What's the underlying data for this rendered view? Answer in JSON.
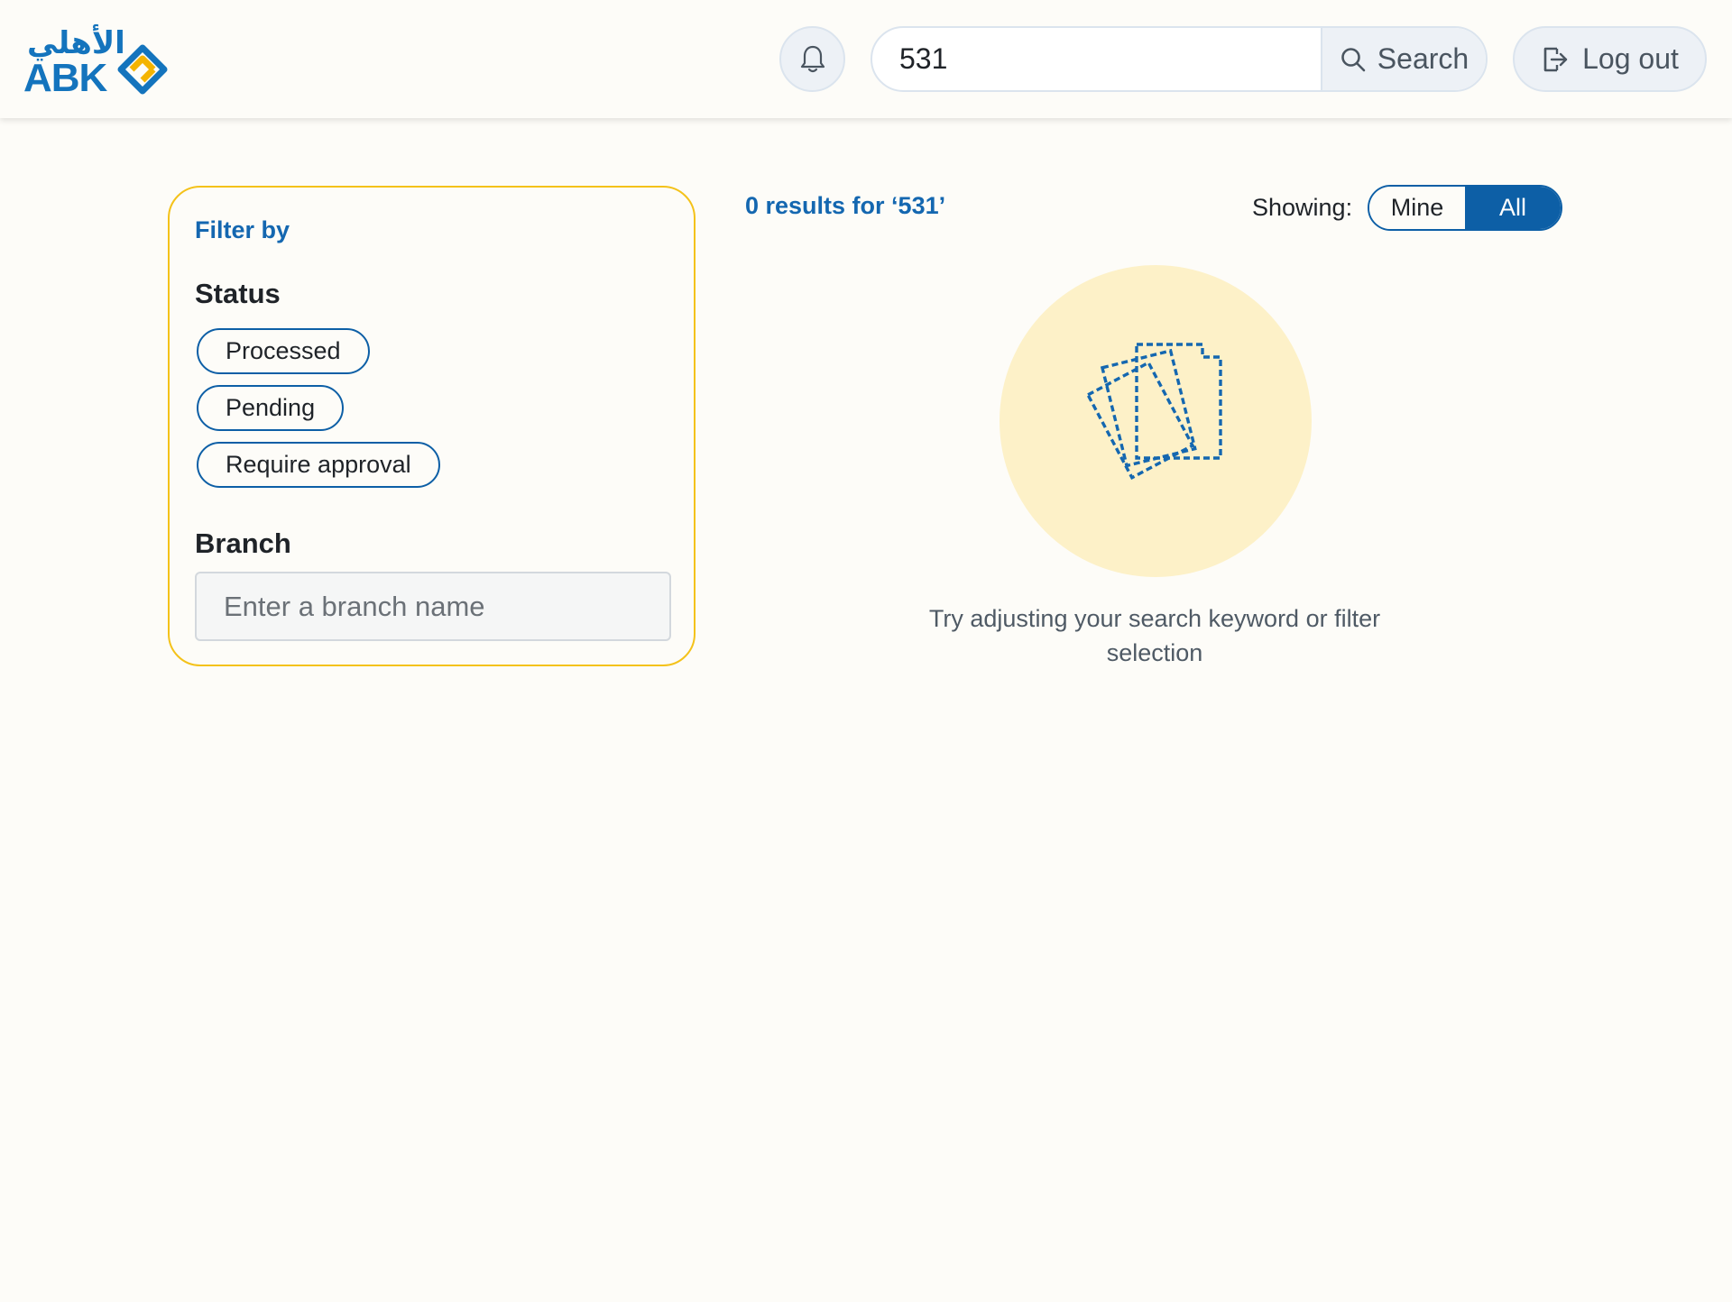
{
  "header": {
    "logo_arabic": "الأهلي",
    "logo_text": "ABK",
    "search": {
      "value": "531",
      "button_label": "Search"
    },
    "logout_label": "Log out"
  },
  "filter": {
    "title": "Filter by",
    "status": {
      "heading": "Status",
      "options": [
        "Processed",
        "Pending",
        "Require approval"
      ]
    },
    "branch": {
      "heading": "Branch",
      "placeholder": "Enter a branch name"
    }
  },
  "results": {
    "count_text": "0 results for ‘531’",
    "showing_label": "Showing:",
    "toggle": {
      "mine": "Mine",
      "all": "All",
      "selected": "All"
    },
    "empty_message": "Try adjusting your search keyword or filter selection"
  },
  "colors": {
    "brand_blue": "#0d5fa6",
    "accent_yellow": "#f4c21a",
    "illustration_bg": "#fdf1c8"
  }
}
